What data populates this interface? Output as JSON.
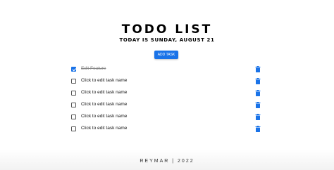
{
  "header": {
    "title": "TODO LIST",
    "date_line": "TODAY IS SUNDAY, AUGUST 21"
  },
  "add_button_label": "ADD TASK",
  "tasks": [
    {
      "name": "Edit Feature",
      "completed": true
    },
    {
      "name": "Click to edit task name",
      "completed": false
    },
    {
      "name": "Click to edit task name",
      "completed": false
    },
    {
      "name": "Click to edit task name",
      "completed": false
    },
    {
      "name": "Click to edit task name",
      "completed": false
    },
    {
      "name": "Click to edit task name",
      "completed": false
    }
  ],
  "icons": {
    "delete": "trash-icon"
  },
  "colors": {
    "accent": "#1a73e8"
  },
  "footer": "REYMAR | 2022"
}
